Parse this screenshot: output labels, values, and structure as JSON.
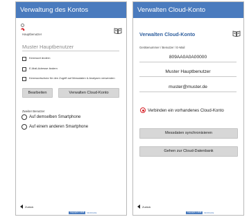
{
  "left": {
    "title": "Verwaltung des Kontos",
    "main_user_label": "Hauptbenutzer",
    "main_user_placeholder": "Muster Hauptbenutzer",
    "checkboxes": [
      {
        "label": "Kennwort ändern",
        "checked": false
      },
      {
        "label": "E-Mail-Adresse ändern",
        "checked": false
      },
      {
        "label": "Kennwortschutz für den Zugriff auf Messdaten & Analysen verwenden",
        "checked": false
      }
    ],
    "edit_button": "Bearbeiten",
    "manage_cloud_button": "Verwalten Cloud-Konto",
    "second_user_title": "Zweiter Benutzer",
    "radios": [
      {
        "label": "Auf demselben Smartphone",
        "selected": false
      },
      {
        "label": "Auf einem anderen Smartphone",
        "selected": false
      }
    ],
    "back_label": "Zurück",
    "footer_badge": "Copyright © 2015",
    "footer_text": "MICROLIFE"
  },
  "right": {
    "title": "Verwalten Cloud-Konto",
    "subtitle": "Verwalten Cloud-Konto",
    "fields_label": "Gerätenummer / Benutzer / E-Mail",
    "device_number": "809AA0A0A00000",
    "user_name": "Muster Hauptbenutzer",
    "email": "muster@muster.de",
    "connect_radio": {
      "label": "Verbinden ein vorhandenes Cloud-Konto",
      "selected": true
    },
    "sync_button": "Messdaten synchronisieren",
    "go_cloud_button": "Gehen zur Cloud-Datenbank",
    "back_label": "Zurück",
    "footer_badge": "Copyright © 2015",
    "footer_text": "MICROLIFE"
  },
  "icons": {
    "book": "book-icon",
    "profile": "user-profile-icon",
    "back": "back-arrow-icon"
  },
  "colors": {
    "titlebar": "#4a7bbe",
    "accent_red": "#d61f26",
    "subtitle_blue": "#2f5f9e"
  }
}
